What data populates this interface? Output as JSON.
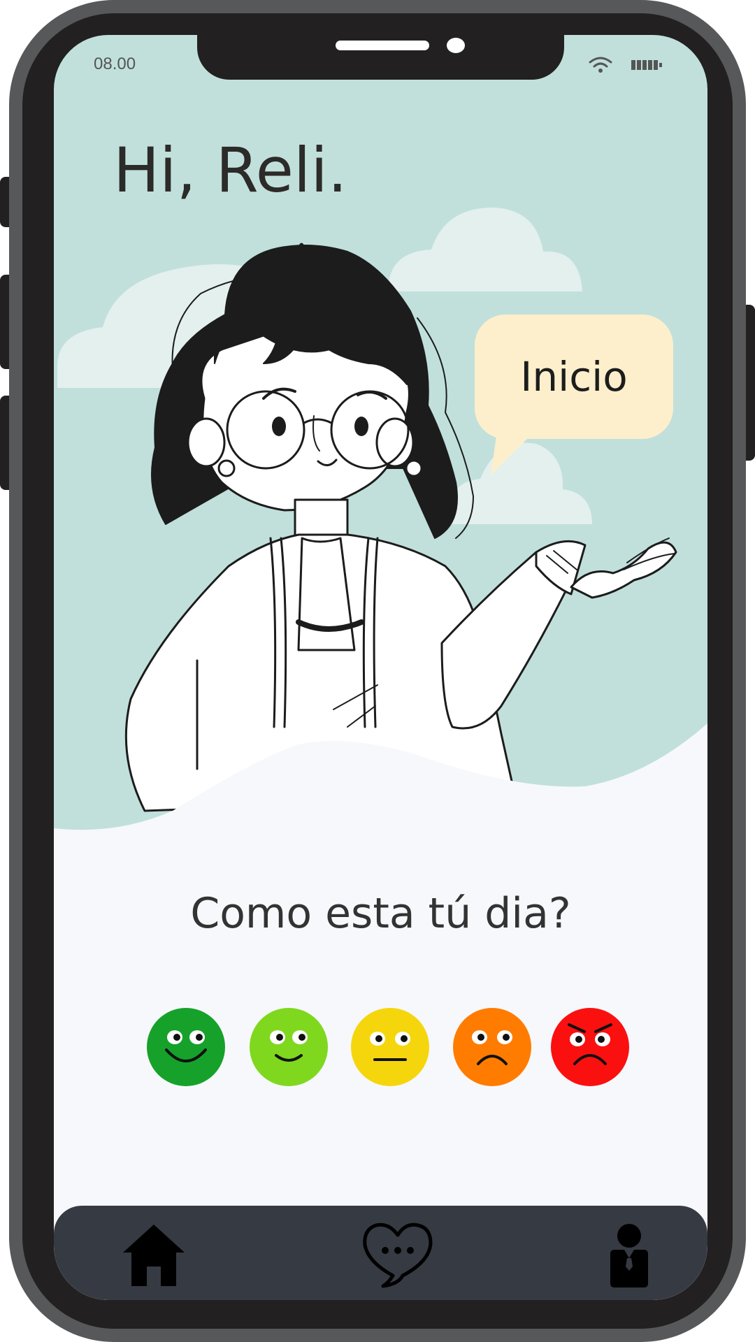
{
  "status_bar": {
    "time": "08.00",
    "wifi_icon": "wifi-icon",
    "battery_icon": "battery-icon"
  },
  "home": {
    "greeting": "Hi, Reli.",
    "speech_bubble": "Inicio",
    "mood_question": "Como esta tú dia?"
  },
  "moods": [
    {
      "icon": "very-happy-face-icon",
      "color": "#16a12b"
    },
    {
      "icon": "happy-face-icon",
      "color": "#7fd81e"
    },
    {
      "icon": "neutral-face-icon",
      "color": "#f5d60c"
    },
    {
      "icon": "sad-face-icon",
      "color": "#ff7c00"
    },
    {
      "icon": "angry-face-icon",
      "color": "#fb1010"
    }
  ],
  "tabbar": {
    "items": [
      {
        "icon": "home-icon"
      },
      {
        "icon": "chat-heart-icon"
      },
      {
        "icon": "profile-icon"
      }
    ]
  },
  "colors": {
    "screen_background": "#c1e0db",
    "content_background": "#f7f8fb",
    "speech_bubble": "#fdefcc",
    "tabbar": "#363a42",
    "device_frame": "#57585a",
    "device_bezel": "#222021"
  }
}
